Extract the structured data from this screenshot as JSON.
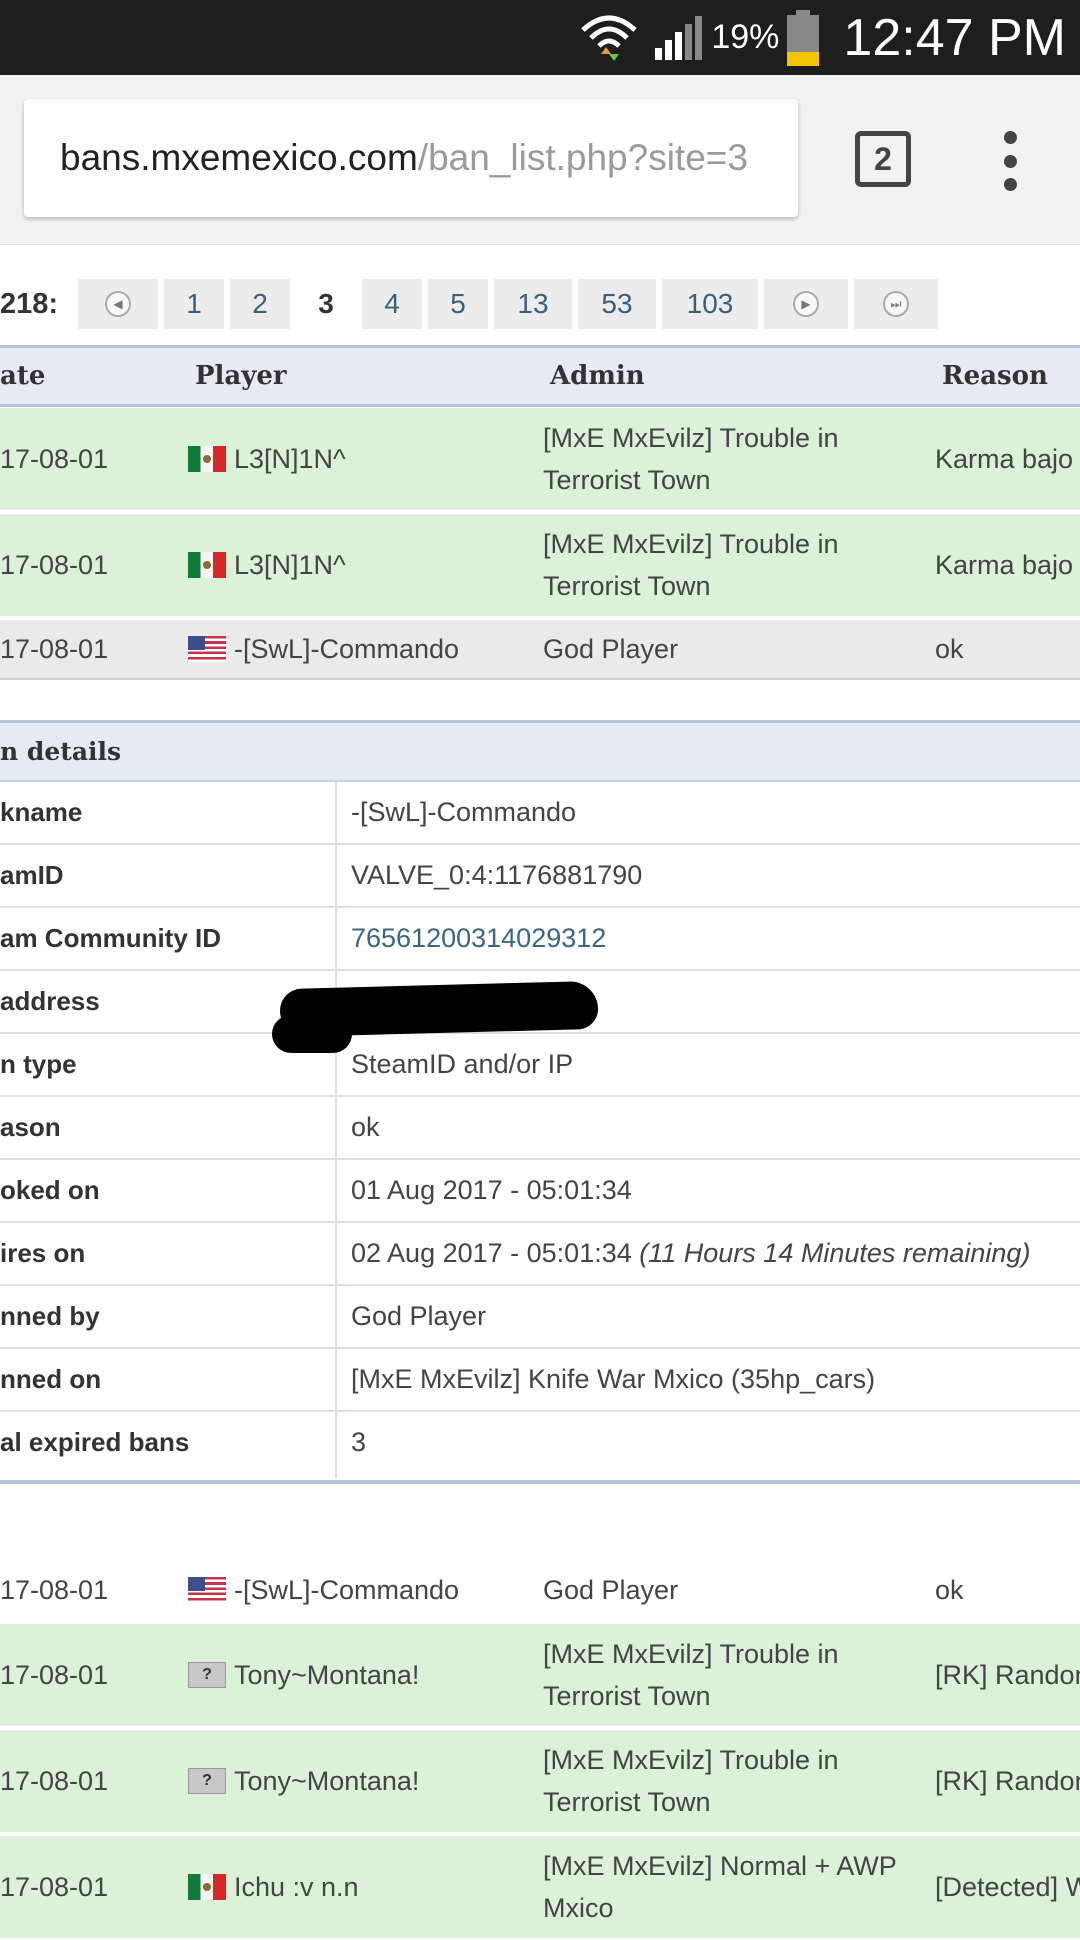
{
  "status_bar": {
    "battery_percent": "19%",
    "time": "12:47 PM"
  },
  "browser": {
    "url_host": "bans.mxemexico.com",
    "url_path": "/ban_list.php?site=3",
    "tab_count": "2"
  },
  "pagination": {
    "label": "218:",
    "pages": [
      "1",
      "2",
      "3",
      "4",
      "5",
      "13",
      "53",
      "103"
    ],
    "current": "3"
  },
  "table": {
    "headers": {
      "date": "ate",
      "player": "Player",
      "admin": "Admin",
      "reason": "Reason"
    },
    "rows_top": [
      {
        "date": "17-08-01",
        "flag": "mx",
        "player": "L3[N]1N^",
        "admin": "[MxE MxEvilz] Trouble in Terrorist Town",
        "reason": "Karma bajo"
      },
      {
        "date": "17-08-01",
        "flag": "mx",
        "player": "L3[N]1N^",
        "admin": "[MxE MxEvilz] Trouble in Terrorist Town",
        "reason": "Karma bajo"
      },
      {
        "date": "17-08-01",
        "flag": "us",
        "player": "-[SwL]-Commando",
        "admin": "God Player",
        "reason": "ok"
      }
    ],
    "rows_bottom": [
      {
        "date": "17-08-01",
        "flag": "us",
        "player": "-[SwL]-Commando",
        "admin": "God Player",
        "reason": "ok"
      },
      {
        "date": "17-08-01",
        "flag": "unknown",
        "player": "Tony~Montana!",
        "admin": "[MxE MxEvilz] Trouble in Terrorist Town",
        "reason": "[RK] Randon"
      },
      {
        "date": "17-08-01",
        "flag": "unknown",
        "player": "Tony~Montana!",
        "admin": "[MxE MxEvilz] Trouble in Terrorist Town",
        "reason": "[RK] Randon"
      },
      {
        "date": "17-08-01",
        "flag": "mx",
        "player": "Ichu :v n.n",
        "admin": "[MxE MxEvilz] Normal + AWP Mxico",
        "reason": "[Detected] W"
      }
    ]
  },
  "ban_details": {
    "title": "n details",
    "rows": [
      {
        "key": "kname",
        "value": "-[SwL]-Commando"
      },
      {
        "key": "amID",
        "value": "VALVE_0:4:1176881790"
      },
      {
        "key": "am Community ID",
        "value": "76561200314029312"
      },
      {
        "key": "address",
        "value": ""
      },
      {
        "key": "n type",
        "value": "SteamID and/or IP"
      },
      {
        "key": "ason",
        "value": "ok"
      },
      {
        "key": "oked on",
        "value": "01 Aug 2017 - 05:01:34"
      },
      {
        "key": "ires on",
        "value": "02 Aug 2017 - 05:01:34",
        "note": "(11 Hours 14 Minutes remaining)"
      },
      {
        "key": "nned by",
        "value": "God Player"
      },
      {
        "key": "nned on",
        "value": "[MxE MxEvilz] Knife War Mxico (35hp_cars)"
      },
      {
        "key": "al expired bans",
        "value": "3"
      }
    ]
  }
}
